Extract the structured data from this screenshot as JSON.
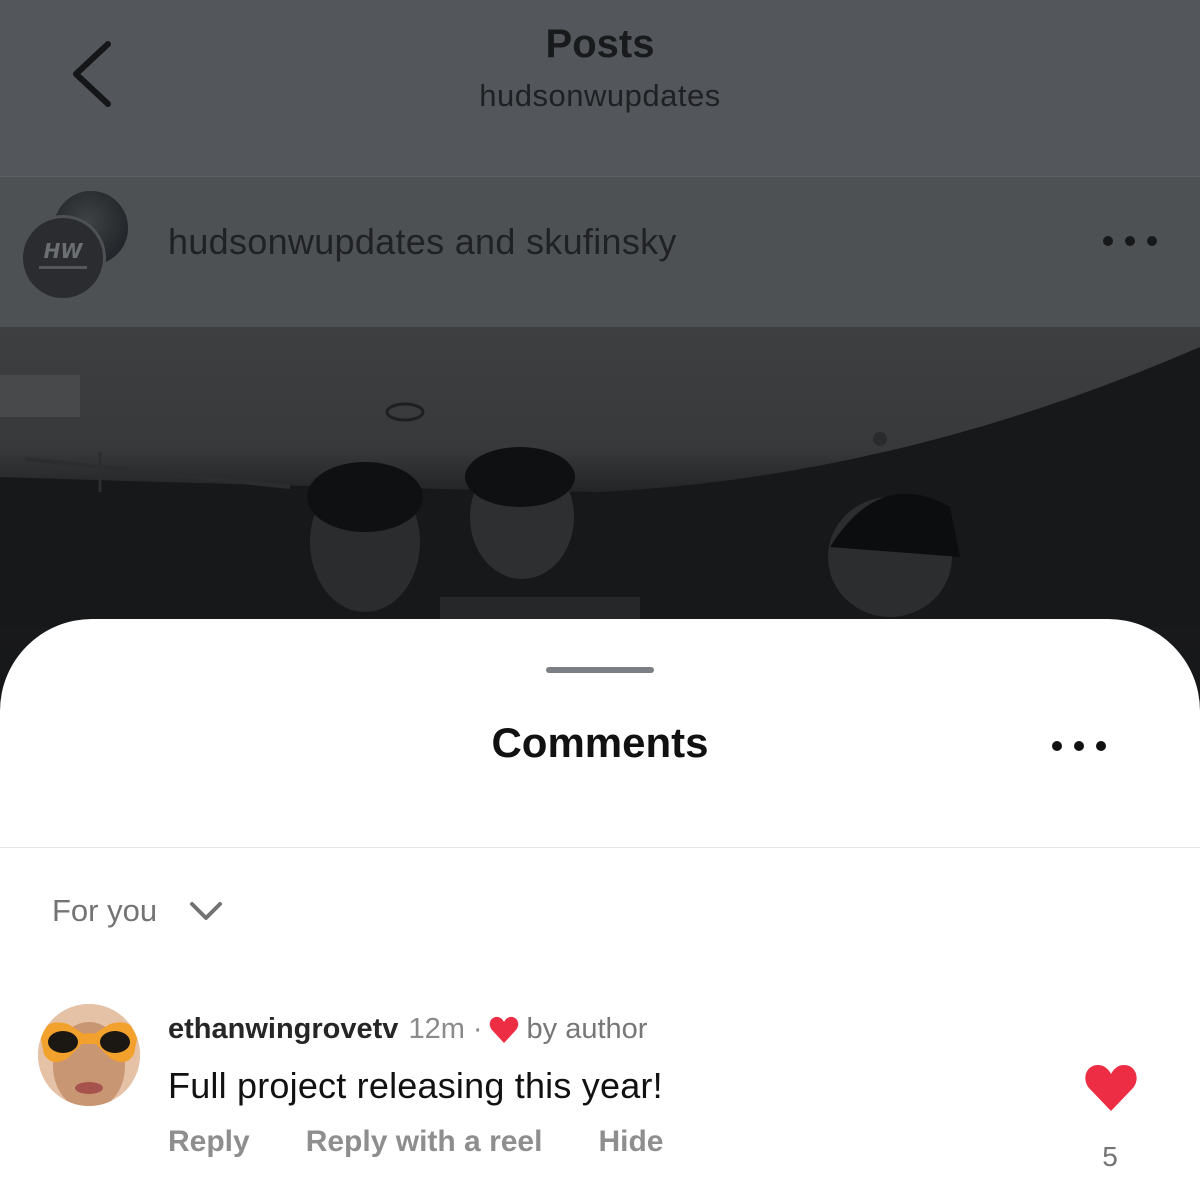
{
  "header": {
    "title": "Posts",
    "subtitle": "hudsonwupdates"
  },
  "post": {
    "authors": "hudsonwupdates and skufinsky"
  },
  "comments_sheet": {
    "title": "Comments",
    "sort_label": "For you",
    "comment": {
      "username": "ethanwingrovetv",
      "time": "12m",
      "separator": "·",
      "liked_by": "by author",
      "text": "Full project releasing this year!",
      "actions": {
        "reply": "Reply",
        "reply_reel": "Reply with a reel",
        "hide": "Hide"
      },
      "like_count": "5"
    }
  },
  "colors": {
    "like_red": "#ed2d43",
    "dim_overlay": "#53565a"
  }
}
